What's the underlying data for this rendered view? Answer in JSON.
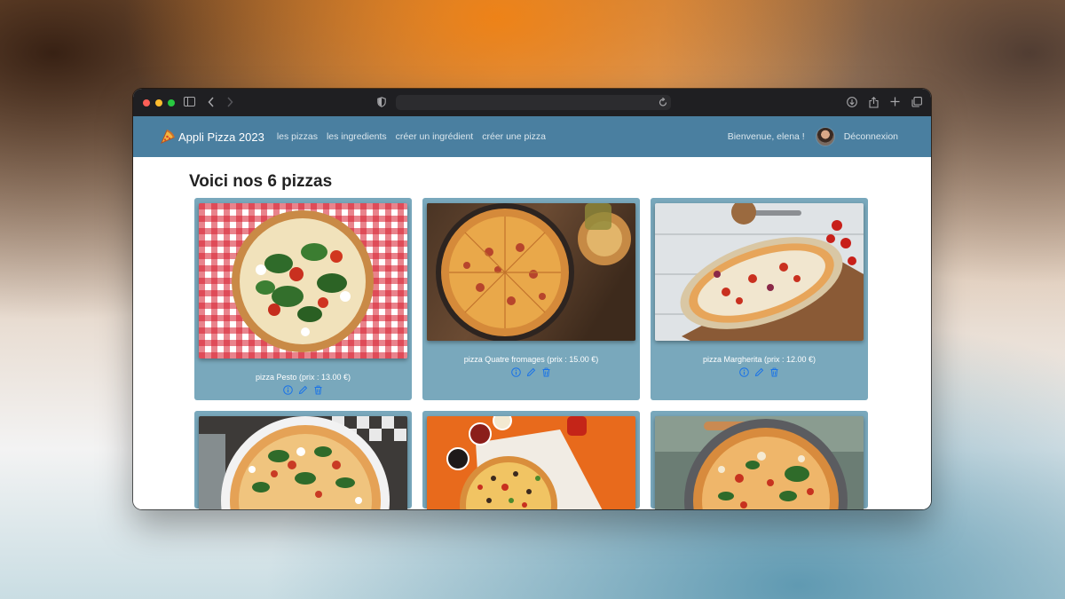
{
  "browser": {
    "url_value": ""
  },
  "navbar": {
    "brand": "Appli Pizza 2023",
    "links": [
      "les pizzas",
      "les ingredients",
      "créer un ingrédient",
      "créer une pizza"
    ],
    "welcome": "Bienvenue, elena !",
    "logout": "Déconnexion"
  },
  "page": {
    "title": "Voici nos 6 pizzas"
  },
  "pizzas": [
    {
      "label": "pizza Pesto (prix : 13.00 €)"
    },
    {
      "label": "pizza Quatre fromages (prix : 15.00 €)"
    },
    {
      "label": "pizza Margherita (prix : 12.00 €)"
    },
    {
      "label": ""
    },
    {
      "label": ""
    },
    {
      "label": ""
    }
  ],
  "icons": {
    "info": "info-icon",
    "edit": "pencil-icon",
    "delete": "trash-icon"
  },
  "colors": {
    "navbar": "#4a7fa0",
    "card": "#79a8bc",
    "action_icon": "#1a73e8"
  }
}
